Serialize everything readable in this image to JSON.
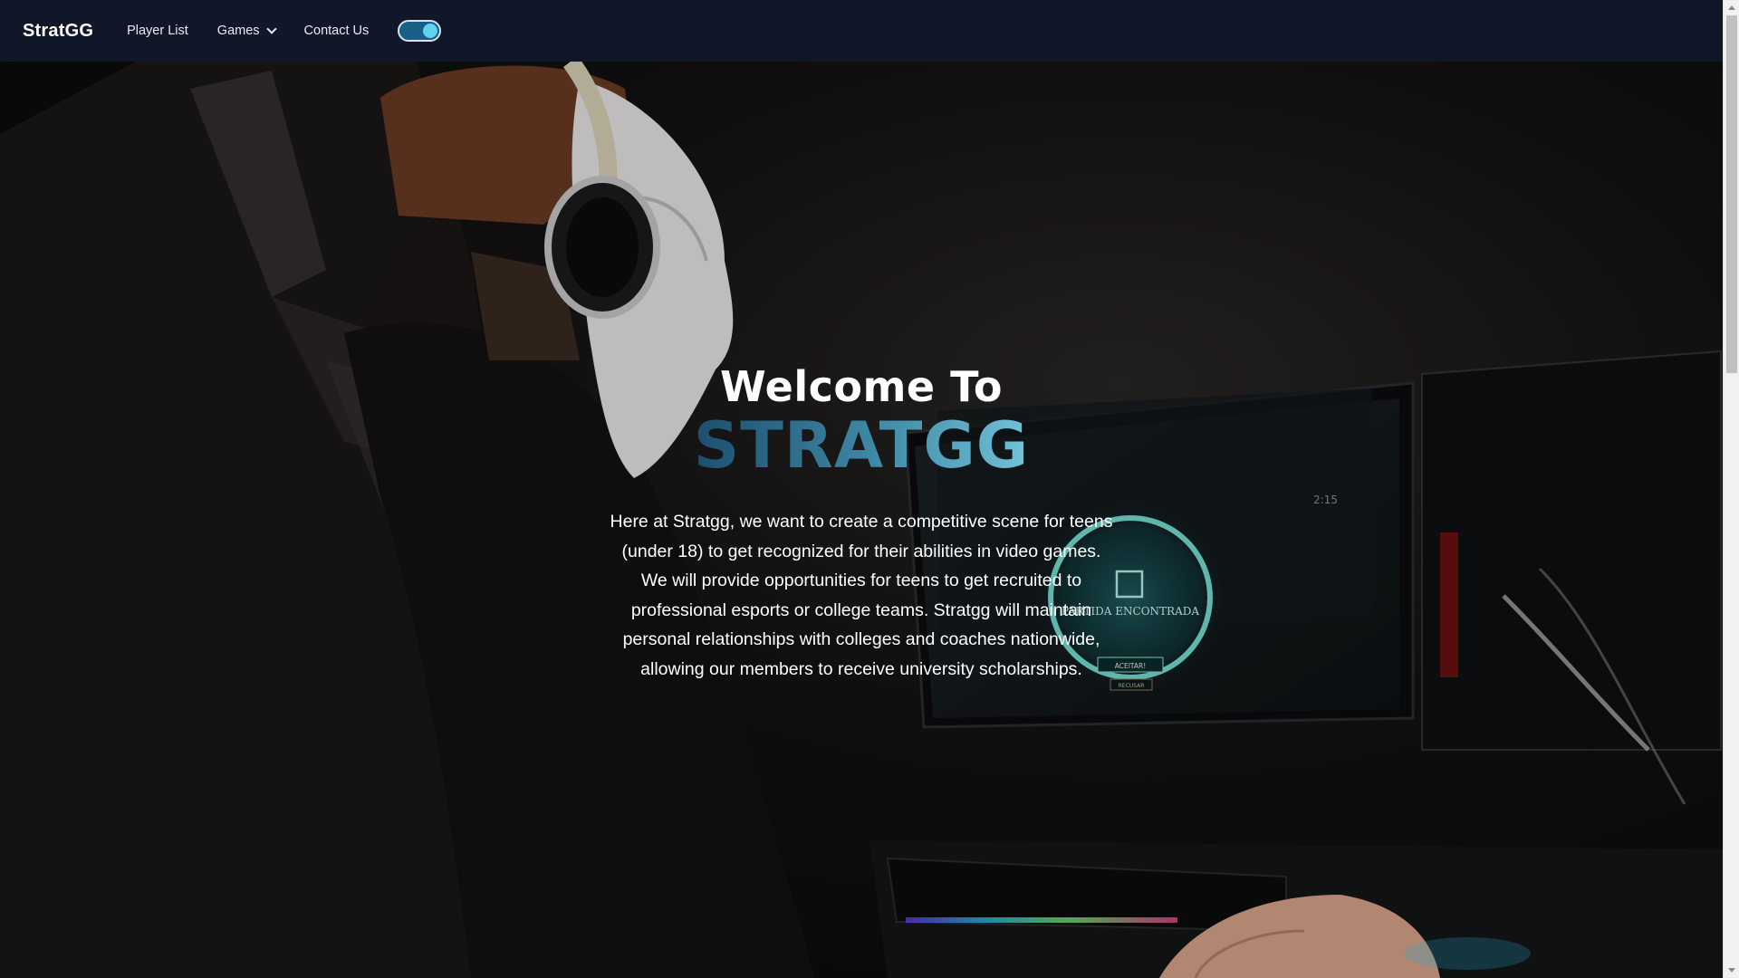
{
  "navbar": {
    "brand": "StratGG",
    "links": [
      {
        "label": "Player List"
      },
      {
        "label": "Games",
        "has_dropdown": true
      },
      {
        "label": "Contact Us"
      }
    ],
    "theme_toggle": {
      "state": "on",
      "track_color": "#1a5f85",
      "knob_color": "#5fd3ee"
    }
  },
  "hero": {
    "title_line1": "Welcome To",
    "title_line2": "STRATGG",
    "description_lines": [
      "Here at Stratgg, we want to create a competitive scene for teens",
      "(under 18) to get recognized for their abilities in video games.",
      "We will provide opportunities for teens to get recruited to",
      "professional esports or college teams. Stratgg will maintain",
      "personal relationships with colleges and coaches nationwide,",
      "allowing our members to receive university scholarships."
    ],
    "monitor_overlay": {
      "title": "PARTIDA ENCONTRADA",
      "accept": "ACEITAR!",
      "decline": "RECUSAR",
      "timer": "2:15"
    }
  },
  "colors": {
    "navbar_bg": "#0f1729",
    "accent_teal": "#3f8aa6"
  }
}
